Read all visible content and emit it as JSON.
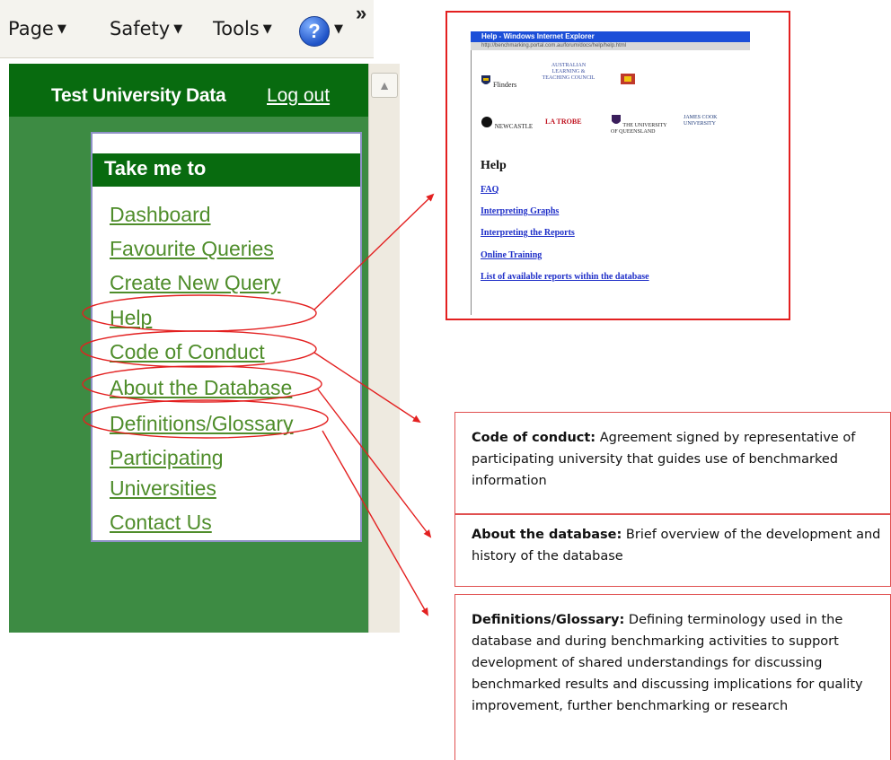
{
  "toolbar": {
    "page_label": "Page",
    "safety_label": "Safety",
    "tools_label": "Tools",
    "help_icon": "help-icon",
    "overflow_icon": "chevron-overflow-icon"
  },
  "site": {
    "title": "Test University Data",
    "logout": "Log out"
  },
  "nav": {
    "heading": "Take me to",
    "items": [
      {
        "label": "Dashboard"
      },
      {
        "label": "Favourite Queries"
      },
      {
        "label": "Create New Query"
      },
      {
        "label": "Help"
      },
      {
        "label": "Code of Conduct"
      },
      {
        "label": "About the Database"
      },
      {
        "label": "Definitions/Glossary"
      },
      {
        "label": "Participating"
      },
      {
        "label": "Universities"
      },
      {
        "label": "Contact Us"
      }
    ]
  },
  "help_window": {
    "title": "Help - Windows Internet Explorer",
    "address": "http://benchmarking.portal.com.au/forum/docs/help/help.html",
    "logos": [
      "Flinders",
      "AUSTRALIAN LEARNING & TEACHING COUNCIL",
      "NEWCASTLE",
      "LA TROBE",
      "THE UNIVERSITY OF QUEENSLAND",
      "JAMES COOK UNIVERSITY"
    ],
    "heading": "Help",
    "links": [
      {
        "label": "FAQ"
      },
      {
        "label": "Interpreting Graphs"
      },
      {
        "label": "Interpreting the Reports"
      },
      {
        "label": "Online Training"
      },
      {
        "label": "List of available reports within the database"
      }
    ]
  },
  "callouts": {
    "code_of_conduct": {
      "term": "Code of conduct:",
      "text": " Agreement signed by representative of participating university that guides use of benchmarked information"
    },
    "about": {
      "term": "About the database:",
      "text": " Brief overview of the development and history of the database"
    },
    "definitions": {
      "term": "Definitions/Glossary:",
      "text": " Defining terminology used in the database and during benchmarking activities to support development of shared understandings for discussing benchmarked results and discussing implications for quality improvement, further benchmarking or research"
    }
  },
  "colors": {
    "header_green": "#086b0f",
    "frame_green": "#3d8b43",
    "link_green": "#4f8d2b",
    "annotation_red": "#e32020"
  }
}
